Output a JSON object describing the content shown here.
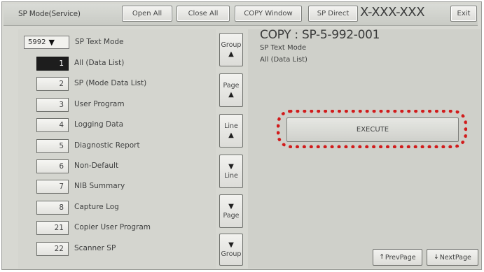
{
  "header": {
    "title": "SP Mode(Service)",
    "open_all": "Open All",
    "close_all": "Close All",
    "copy_window": "COPY Window",
    "sp_direct": "SP Direct",
    "code": "X-XXX-XXX",
    "exit": "Exit"
  },
  "left_panel": {
    "selector_value": "5992",
    "selector_arrow": "▼",
    "mode_label": "SP Text Mode",
    "items": [
      {
        "num": "1",
        "label": "All (Data List)",
        "active": true
      },
      {
        "num": "2",
        "label": "SP (Mode Data List)",
        "active": false
      },
      {
        "num": "3",
        "label": "User Program",
        "active": false
      },
      {
        "num": "4",
        "label": "Logging Data",
        "active": false
      },
      {
        "num": "5",
        "label": "Diagnostic Report",
        "active": false
      },
      {
        "num": "6",
        "label": "Non-Default",
        "active": false
      },
      {
        "num": "7",
        "label": "NIB Summary",
        "active": false
      },
      {
        "num": "8",
        "label": "Capture Log",
        "active": false
      },
      {
        "num": "21",
        "label": "Copier User Program",
        "active": false
      },
      {
        "num": "22",
        "label": "Scanner SP",
        "active": false
      }
    ]
  },
  "nav": {
    "group_up": {
      "text": "Group",
      "arrow": "▲"
    },
    "page_up": {
      "text": "Page",
      "arrow": "▲"
    },
    "line_up": {
      "text": "Line",
      "arrow": "▲"
    },
    "line_down": {
      "text": "Line",
      "arrow": "▼"
    },
    "page_down": {
      "text": "Page",
      "arrow": "▼"
    },
    "group_down": {
      "text": "Group",
      "arrow": "▼"
    }
  },
  "right_panel": {
    "code": "COPY : SP-5-992-001",
    "line1": "SP Text Mode",
    "line2": "All (Data List)",
    "execute": "EXECUTE",
    "prev_page": "PrevPage",
    "next_page": "NextPage"
  },
  "colors": {
    "highlight": "#d11b1b",
    "active_item_bg": "#1d1d1d"
  }
}
